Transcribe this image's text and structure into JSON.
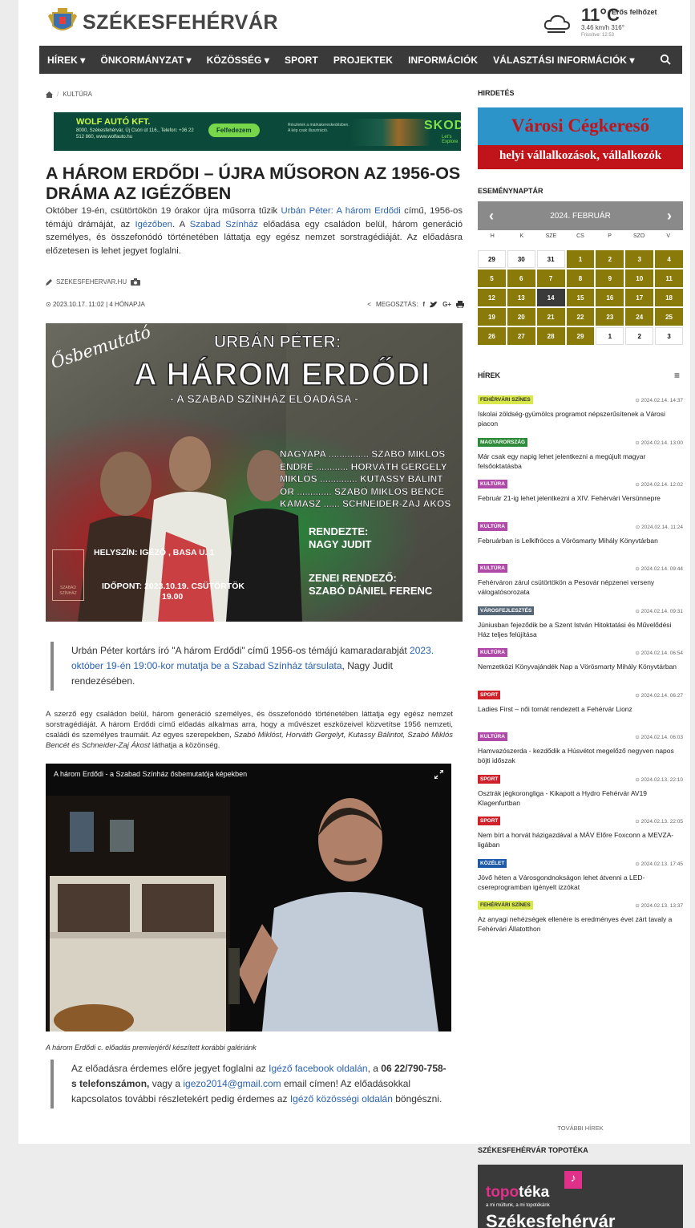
{
  "site": {
    "name": "SZÉKESFEHÉRVÁR"
  },
  "weather": {
    "temp": "11°C",
    "desc": "Erős felhőzet",
    "wind": "3.46 km/h  316°",
    "updated": "Frissítve: 12:53"
  },
  "nav": [
    "HÍREK ▾",
    "ÖNKORMÁNYZAT ▾",
    "KÖZÖSSÉG ▾",
    "SPORT",
    "PROJEKTEK",
    "INFORMÁCIÓK",
    "VÁLASZTÁSI INFORMÁCIÓK ▾"
  ],
  "breadcrumb": {
    "section": "KULTÚRA"
  },
  "ad_top": {
    "company": "WOLF AUTÓ KFT.",
    "address": "8000, Székesfehérvár, Új Csóri út 116., Telefon: +36 22 512 860, www.wolfauto.hu",
    "button": "Felfedezem",
    "blurb": "Részletek a márkakereskedésben. A kép csak illusztráció.",
    "brand": "SKODA",
    "tagline": "Let's Explore"
  },
  "article": {
    "title": "A HÁROM ERDŐDI – ÚJRA MŰSORON AZ 1956-OS DRÁMA AZ IGÉZŐBEN",
    "lead_1": "Október 19-én, csütörtökön 19 órakor újra műsorra tűzik ",
    "lead_link1": "Urbán Péter: A három Erdődi",
    "lead_2": " című, 1956-os témájú drámáját, az ",
    "lead_link2": "Igézőben",
    "lead_3": ". A ",
    "lead_link3": "Szabad Színház",
    "lead_4": " előadása egy családon belül, három generáció személyes, és összefonódó történetében láttatja egy egész nemzet sorstragédiáját. Az előadásra előzetesen is lehet jegyet foglalni.",
    "source": "SZEKESFEHERVAR.HU",
    "date": "2023.10.17. 11:02 | 4 HÓNAPJA",
    "share": "MEGOSZTÁS:",
    "quote_1": "Urbán Péter kortárs író \"A három Erdődi\" című 1956-os témájú kamaradarabját ",
    "quote_link": "2023. október 19-én 19:00-kor mutatja be a Szabad Színház társulata",
    "quote_2": ", Nagy Judit rendezésében.",
    "body_1": "A szerző egy családon belül, három generáció személyes, és összefonódó történetében láttatja egy egész nemzet sorstragédiáját. A három Erdődi című előadás alkalmas arra, hogy a művészet eszközeivel közvetítse 1956 nemzeti, családi és személyes traumáit. Az egyes szerepekben, ",
    "body_names": "Szabó Miklóst, Horváth Gergelyt, Kutassy Bálintot, Szabó Miklós Bencét és Schneider-Zaj Ákost",
    "body_2": " láthatja a közönség.",
    "video_title": "A három Erdődi - a Szabad Színház ősbemutatója képekben",
    "caption": "A három Erdődi c. előadás premierjéről készített korábbi galériánk",
    "q2_1": "Az előadásra érdemes előre jegyet foglalni az ",
    "q2_link1": "Igéző facebook oldalán",
    "q2_2": ", a ",
    "q2_phone": "06 22/790-758-s telefonszámon,",
    "q2_3": " vagy a ",
    "q2_link2": "igezo2014@gmail.com",
    "q2_4": " email címen! Az előadásokkal kapcsolatos további részletekért pedig érdemes az ",
    "q2_link3": "Igéző közösségi oldalán",
    "q2_5": " böngészni."
  },
  "poster": {
    "osbemutato": "Ősbemutató",
    "author": "URBÁN PÉTER:",
    "title": "A HÁROM ERDŐDI",
    "subtitle": "- A SZABAD SZÍNHÁZ ELŐADÁSA -",
    "cast": [
      "NAGYAPA ............... SZABÓ MIKLÓS",
      "ENDRE ............ HORVÁTH GERGELY",
      "MIKLÓS .............. KUTASSY BÁLINT",
      "ŐR ............. SZABÓ MIKLÓS BENCE",
      "KAMASZ ...... SCHNEIDER-ZAJ ÁKOS"
    ],
    "director_label": "RENDEZTE:",
    "director": "NAGY JUDIT",
    "music_label": "ZENEI RENDEZŐ:",
    "music": "SZABÓ DÁNIEL FERENC",
    "venue": "HELYSZÍN: IGÉZŐ , BASA U. 1",
    "time": "IDŐPONT: 2023.10.19. CSÜTÖRTÖK",
    "time2": "19.00",
    "logo_text": "SZABAD SZÍNHÁZ"
  },
  "sidebar": {
    "ad_label": "HIRDETÉS",
    "ad_title": "Városi Cégkereső",
    "ad_sub": "helyi vállalkozások, vállalkozók",
    "cal_label": "ESEMÉNYNAPTÁR",
    "cal_month": "2024. FEBRUÁR",
    "dows": [
      "H",
      "K",
      "SZE",
      "CS",
      "P",
      "SZO",
      "V"
    ],
    "days": [
      "29",
      "30",
      "31",
      "1",
      "2",
      "3",
      "4",
      "5",
      "6",
      "7",
      "8",
      "9",
      "10",
      "11",
      "12",
      "13",
      "14",
      "15",
      "16",
      "17",
      "18",
      "19",
      "20",
      "21",
      "22",
      "23",
      "24",
      "25",
      "26",
      "27",
      "28",
      "29",
      "1",
      "2",
      "3"
    ],
    "news_label": "HÍREK",
    "news": [
      {
        "tag": "FEHÉRVÁRI SZÍNES",
        "color": "#d8e84a",
        "tagcolor": "#333",
        "date": "2024.02.14. 14:37",
        "title": "Iskolai zöldség-gyümölcs programot népszerűsítenek a Városi piacon"
      },
      {
        "tag": "MAGYARORSZÁG",
        "color": "#2e8b3a",
        "tagcolor": "#fff",
        "date": "2024.02.14. 13:00",
        "title": "Már csak egy napig lehet jelentkezni a megújult magyar felsőoktatásba"
      },
      {
        "tag": "KULTÚRA",
        "color": "#b04aa8",
        "tagcolor": "#fff",
        "date": "2024.02.14. 12:02",
        "title": "Február 21-ig lehet jelentkezni a XIV. Fehérvári Versünnepre"
      },
      {
        "tag": "KULTÚRA",
        "color": "#b04aa8",
        "tagcolor": "#fff",
        "date": "2024.02.14. 11:24",
        "title": "Februárban is Lelkifröccs a Vörösmarty Mihály Könyvtárban"
      },
      {
        "tag": "KULTÚRA",
        "color": "#b04aa8",
        "tagcolor": "#fff",
        "date": "2024.02.14. 09:44",
        "title": "Fehérváron zárul csütörtökön a Pesovár népzenei verseny válogatósorozata"
      },
      {
        "tag": "VÁROSFEJLESZTÉS",
        "color": "#556677",
        "tagcolor": "#fff",
        "date": "2024.02.14. 09:31",
        "title": "Júniusban fejeződik be a Szent István Hitoktatási és Művelődési Ház teljes felújítása"
      },
      {
        "tag": "KULTÚRA",
        "color": "#b04aa8",
        "tagcolor": "#fff",
        "date": "2024.02.14. 06:54",
        "title": "Nemzetközi Könyvajándék Nap a Vörösmarty Mihály Könyvtárban"
      },
      {
        "tag": "SPORT",
        "color": "#d0202a",
        "tagcolor": "#fff",
        "date": "2024.02.14. 06:27",
        "title": "Ladies First – női tornát rendezett a Fehérvár Lionz"
      },
      {
        "tag": "KULTÚRA",
        "color": "#b04aa8",
        "tagcolor": "#fff",
        "date": "2024.02.14. 06:03",
        "title": "Hamvazószerda - kezdődik a Húsvétot megelőző negyven napos böjti időszak"
      },
      {
        "tag": "SPORT",
        "color": "#d0202a",
        "tagcolor": "#fff",
        "date": "2024.02.13. 22:10",
        "title": "Osztrák jégkorongliga - Kikapott a Hydro Fehérvár AV19 Klagenfurtban"
      },
      {
        "tag": "SPORT",
        "color": "#d0202a",
        "tagcolor": "#fff",
        "date": "2024.02.13. 22:05",
        "title": "Nem bírt a horvát házigazdával a MÁV Előre Foxconn a MEVZA-ligában"
      },
      {
        "tag": "KÖZÉLET",
        "color": "#1f5aa8",
        "tagcolor": "#fff",
        "date": "2024.02.13. 17:45",
        "title": "Jövő héten a Városgondnokságon lehet átvenni a LED-csereprogramban igényelt izzókat"
      },
      {
        "tag": "FEHÉRVÁRI SZÍNES",
        "color": "#d8e84a",
        "tagcolor": "#333",
        "date": "2024.02.13. 13:37",
        "title": "Az anyagi nehézségek ellenére is eredményes évet zárt tavaly a Fehérvári Állatotthon"
      }
    ],
    "more": "TOVÁBBI HÍREK",
    "topo_label": "SZÉKESFEHÉRVÁR TOPOTÉKA",
    "topo_logo_a": "topo",
    "topo_logo_b": "téka",
    "topo_tag": "a mi múltunk, a mi topotékánk",
    "topo_city": "Székesfehérvár"
  }
}
